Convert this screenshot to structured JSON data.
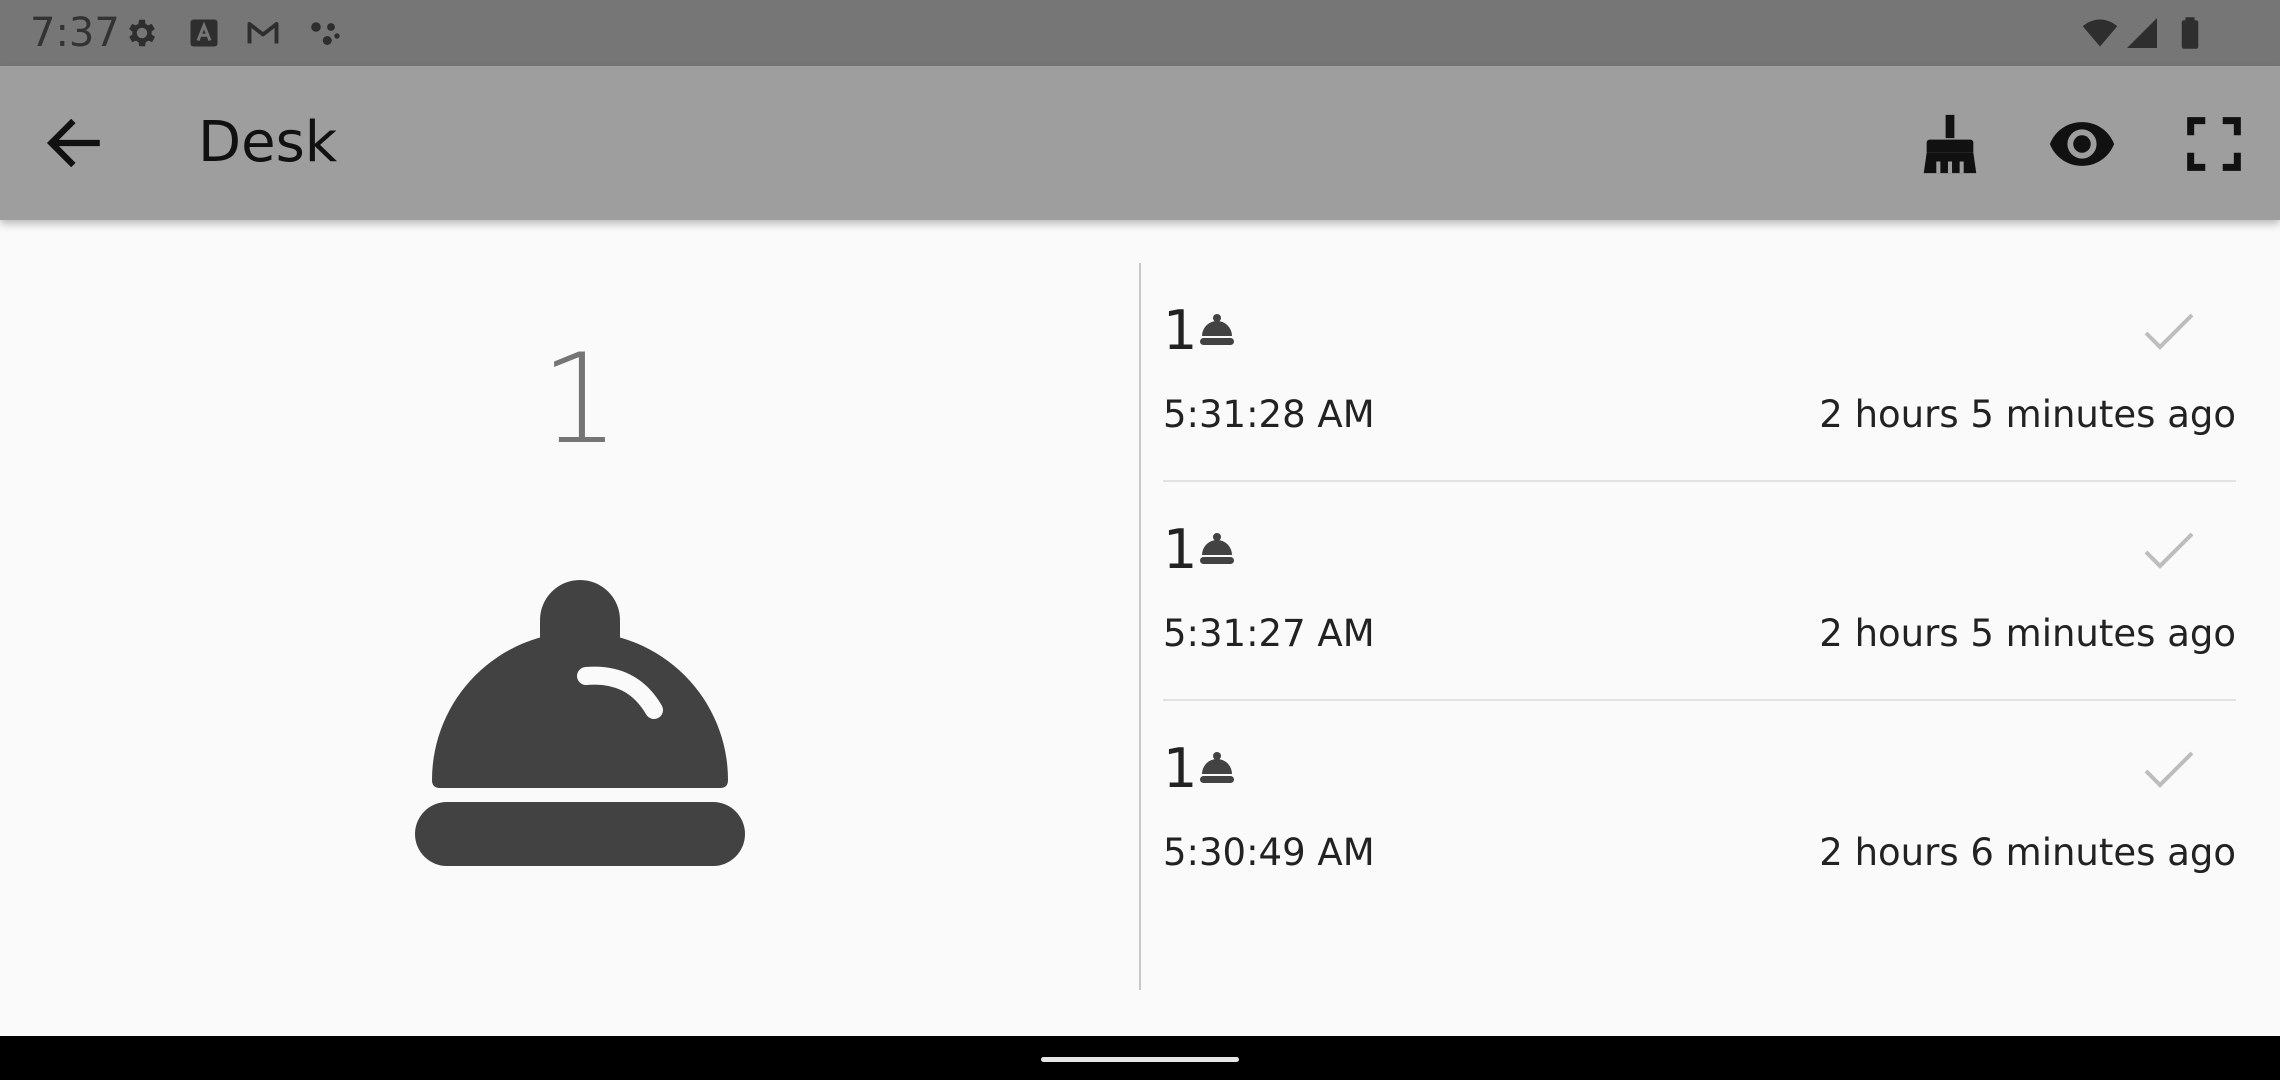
{
  "status_bar": {
    "time": "7:37",
    "left_icons": [
      "gear-icon",
      "font-a-icon",
      "gmail-icon",
      "assistant-dots-icon"
    ],
    "right_icons": [
      "wifi-icon",
      "signal-icon",
      "battery-icon"
    ]
  },
  "app_bar": {
    "title": "Desk",
    "back_icon": "arrow-back-icon",
    "actions": [
      "broom-icon",
      "eye-icon",
      "fullscreen-icon"
    ]
  },
  "summary": {
    "count": "1",
    "icon": "bell-icon"
  },
  "list": {
    "items": [
      {
        "count": "1",
        "time": "5:31:28 AM",
        "ago": "2 hours 5 minutes ago"
      },
      {
        "count": "1",
        "time": "5:31:27 AM",
        "ago": "2 hours 5 minutes ago"
      },
      {
        "count": "1",
        "time": "5:30:49 AM",
        "ago": "2 hours 6 minutes ago"
      }
    ]
  },
  "colors": {
    "status_bar": "#767676",
    "app_bar": "#9e9e9e",
    "background": "#fafafa",
    "icon_dark": "#424242",
    "check_muted": "#bdbdbd"
  }
}
